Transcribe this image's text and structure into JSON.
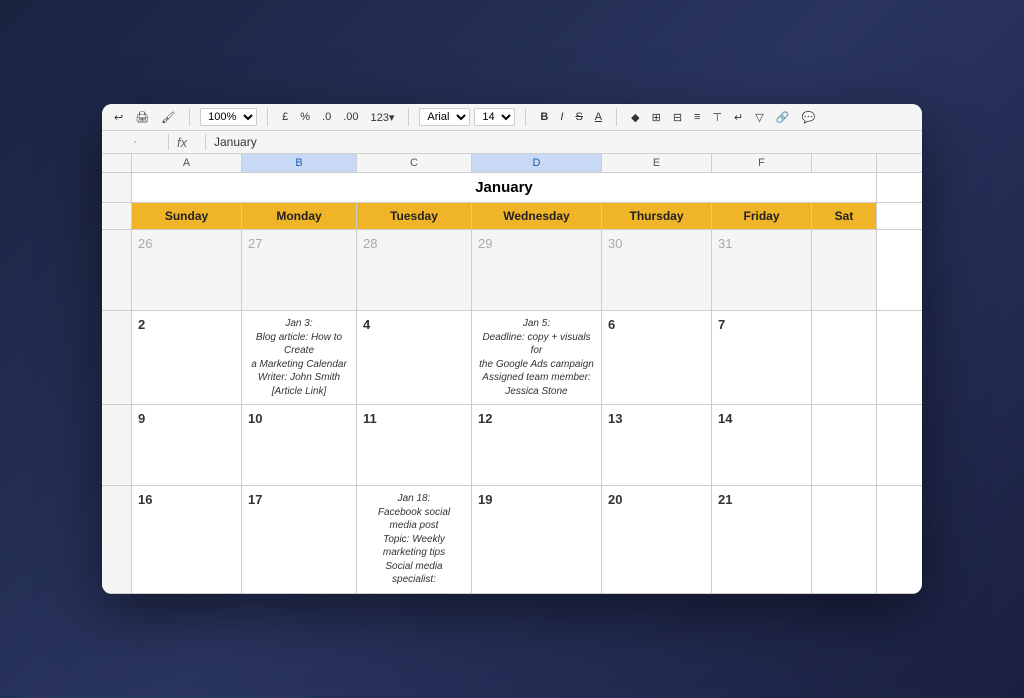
{
  "toolbar": {
    "zoom": "100%",
    "currency": "£",
    "percent": "%",
    "decimal1": ".0",
    "decimal2": ".00",
    "format123": "123▾",
    "font": "Arial",
    "fontsize": "14",
    "bold": "B",
    "italic": "I",
    "strike": "S",
    "underline": "A"
  },
  "formula_bar": {
    "cell_ref": "·",
    "fx": "fx",
    "content": "January"
  },
  "col_labels": [
    "",
    "A",
    "B",
    "C",
    "D",
    "E",
    "F",
    ""
  ],
  "calendar": {
    "title": "January",
    "day_headers": [
      "Sunday",
      "Monday",
      "Tuesday",
      "Wednesday",
      "Thursday",
      "Friday",
      "Sat"
    ],
    "weeks": [
      {
        "row_num": "",
        "days": [
          {
            "day": "26",
            "type": "prev",
            "event": ""
          },
          {
            "day": "27",
            "type": "prev",
            "event": ""
          },
          {
            "day": "28",
            "type": "prev",
            "event": ""
          },
          {
            "day": "29",
            "type": "prev",
            "event": ""
          },
          {
            "day": "30",
            "type": "prev",
            "event": ""
          },
          {
            "day": "31",
            "type": "prev",
            "event": ""
          },
          {
            "day": "",
            "type": "prev",
            "event": ""
          }
        ]
      },
      {
        "row_num": "",
        "days": [
          {
            "day": "2",
            "type": "current",
            "event": ""
          },
          {
            "day": "",
            "type": "current",
            "event": "Jan 3:\nBlog article: How to Create\na Marketing Calendar\nWriter: John Smith\n[Article Link]",
            "color": "green"
          },
          {
            "day": "4",
            "type": "current",
            "event": ""
          },
          {
            "day": "",
            "type": "current",
            "event": "Jan 5:\nDeadline: copy + visuals for\nthe Google Ads campaign\nAssigned team member:\nJessica Stone",
            "color": "red"
          },
          {
            "day": "6",
            "type": "current",
            "event": ""
          },
          {
            "day": "7",
            "type": "current",
            "event": ""
          },
          {
            "day": "",
            "type": "current",
            "event": ""
          }
        ]
      },
      {
        "row_num": "",
        "days": [
          {
            "day": "9",
            "type": "current",
            "event": ""
          },
          {
            "day": "10",
            "type": "current",
            "event": ""
          },
          {
            "day": "11",
            "type": "current",
            "event": ""
          },
          {
            "day": "12",
            "type": "current",
            "event": ""
          },
          {
            "day": "13",
            "type": "current",
            "event": ""
          },
          {
            "day": "14",
            "type": "current",
            "event": ""
          },
          {
            "day": "",
            "type": "current",
            "event": ""
          }
        ]
      },
      {
        "row_num": "",
        "days": [
          {
            "day": "16",
            "type": "current",
            "event": ""
          },
          {
            "day": "17",
            "type": "current",
            "event": ""
          },
          {
            "day": "",
            "type": "current",
            "event": "Jan 18:\nFacebook social media post\nTopic: Weekly marketing tips\nSocial media specialist:",
            "color": "blue"
          },
          {
            "day": "19",
            "type": "current",
            "event": ""
          },
          {
            "day": "20",
            "type": "current",
            "event": ""
          },
          {
            "day": "21",
            "type": "current",
            "event": ""
          },
          {
            "day": "",
            "type": "current",
            "event": ""
          }
        ]
      }
    ]
  }
}
